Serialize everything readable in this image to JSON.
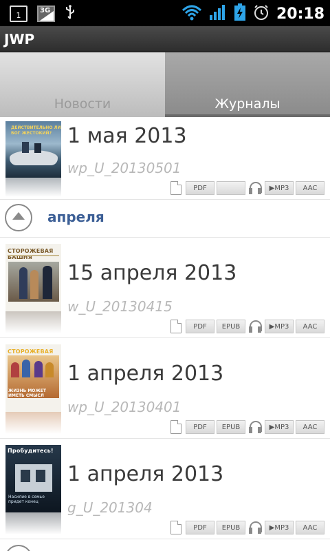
{
  "status_bar": {
    "time": "20:18",
    "sim_label": "1",
    "network_label": "3G",
    "icons": [
      "sim-icon",
      "network-3g-icon",
      "usb-icon",
      "wifi-icon",
      "signal-icon",
      "battery-charging-icon",
      "alarm-icon"
    ]
  },
  "app": {
    "title": "JWP"
  },
  "tabs": [
    {
      "label": "Новости",
      "selected": false
    },
    {
      "label": "Журналы",
      "selected": true
    }
  ],
  "issues_top": [
    {
      "title": "1 мая 2013",
      "code": "wp_U_20130501",
      "formats": {
        "pdf": "PDF",
        "epub": "",
        "mp3": "▶MP3",
        "aac": "AAC"
      }
    }
  ],
  "section": {
    "label": "апреля"
  },
  "issues_april": [
    {
      "title": "15 апреля 2013",
      "code": "w_U_20130415",
      "formats": {
        "pdf": "PDF",
        "epub": "EPUB",
        "mp3": "▶MP3",
        "aac": "AAC"
      }
    },
    {
      "title": "1 апреля 2013",
      "code": "wp_U_20130401",
      "formats": {
        "pdf": "PDF",
        "epub": "EPUB",
        "mp3": "▶MP3",
        "aac": "AAC"
      }
    },
    {
      "title": "1 апреля 2013",
      "code": "g_U_201304",
      "formats": {
        "pdf": "PDF",
        "epub": "EPUB",
        "mp3": "▶MP3",
        "aac": "AAC"
      }
    }
  ],
  "covers": {
    "c0_lines": [
      "ДЕЙСТВИТЕЛЬНО ЛИ",
      "БОГ ЖЕСТОКИЙ?"
    ],
    "c1_masthead": "СТОРОЖЕВАЯ БАШНЯ",
    "c2_masthead": "СТОРОЖЕВАЯ БАШНЯ",
    "c2_lines": [
      "ЖИЗНЬ МОЖЕТ",
      "ИМЕТЬ СМЫСЛ"
    ],
    "c3_masthead": "Пробудитесь!",
    "c3_lines": [
      "Насилие в семье",
      "придет конец"
    ]
  },
  "colors": {
    "section_label": "#3c5f96",
    "title_text": "#3a3a3a",
    "code_text": "#b8b8b8",
    "tab_selected_text": "#ffffff",
    "tab_unselected_text": "#9a9a9a"
  }
}
